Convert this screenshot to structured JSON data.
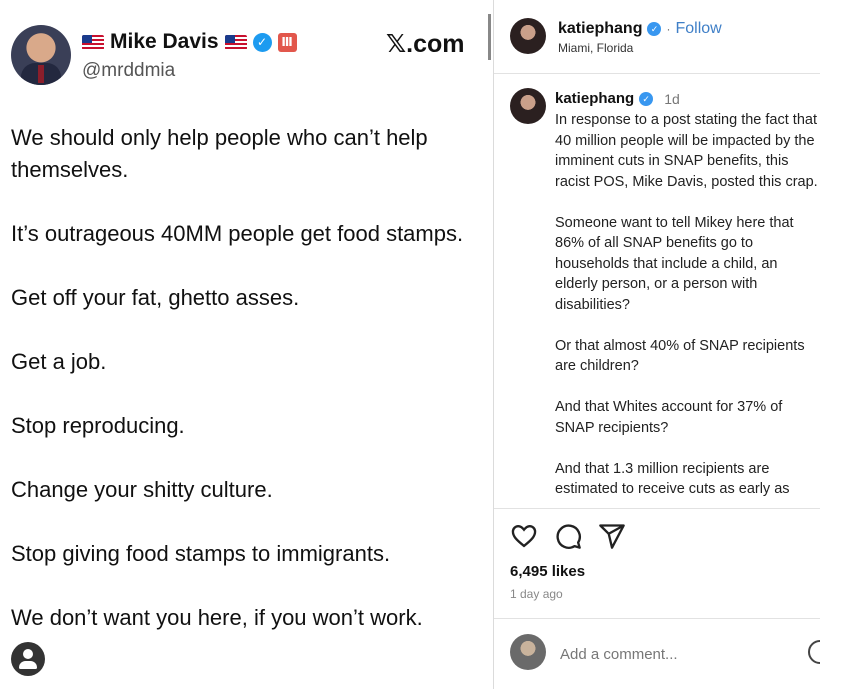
{
  "tweet": {
    "author": "Mike Davis",
    "flag_left": "us-flag-icon",
    "flag_right": "us-flag-icon",
    "verified_icon": "verified-badge-icon",
    "extra_badge": "Ⅲ",
    "handle": "@mrddmia",
    "watermark": "𝕏.com",
    "lines": [
      "We should only help people who can’t help themselves.",
      "It’s outrageous 40MM people get food stamps.",
      "Get off your fat, ghetto asses.",
      "Get a job.",
      "Stop reproducing.",
      "Change your shitty culture.",
      "Stop giving food stamps to immigrants.",
      "We don’t want you here, if you won’t work."
    ]
  },
  "post": {
    "username": "katiephang",
    "follow_label": "Follow",
    "separator": "·",
    "location": "Miami, Florida",
    "caption_time": "1d",
    "caption": [
      "In response to a post stating the fact that 40 million people will be impacted by the imminent cuts in SNAP benefits, this racist POS, Mike Davis, posted this crap.",
      "Someone want to tell Mikey here that 86% of all SNAP benefits go to households that include a child, an elderly person, or a person with disabilities?",
      "Or that almost 40% of SNAP recipients are children?",
      "And that Whites account for 37% of SNAP recipients?",
      "And that 1.3 million recipients are estimated to receive cuts as early as"
    ],
    "likes": "6,495 likes",
    "date": "1 day ago",
    "comment_placeholder": "Add a comment..."
  },
  "colors": {
    "verified": "#1d9bf0",
    "ig_verified": "#3897f0",
    "follow": "#3f7fc7",
    "badge": "#e2574c"
  }
}
